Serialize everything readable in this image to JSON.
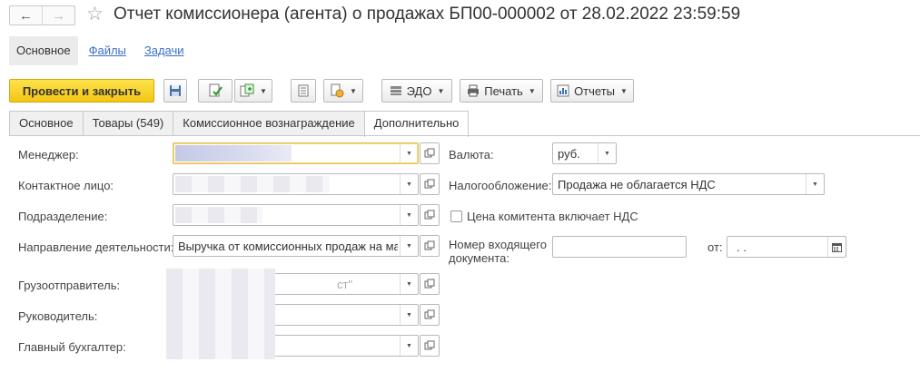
{
  "window": {
    "title": "Отчет комиссионера (агента) о продажах БП00-000002 от 28.02.2022 23:59:59"
  },
  "topnav": [
    {
      "label": "Основное"
    },
    {
      "label": "Файлы"
    },
    {
      "label": "Задачи"
    }
  ],
  "toolbar": {
    "post_close": "Провести и закрыть",
    "edo": "ЭДО",
    "print": "Печать",
    "reports": "Отчеты"
  },
  "tabs": [
    {
      "label": "Основное"
    },
    {
      "label": "Товары (549)"
    },
    {
      "label": "Комиссионное вознаграждение"
    },
    {
      "label": "Дополнительно"
    }
  ],
  "form": {
    "manager_label": "Менеджер:",
    "contact_label": "Контактное лицо:",
    "department_label": "Подразделение:",
    "activity_label": "Направление деятельности:",
    "activity_value": "Выручка от комиссионных продаж на ма",
    "shipper_label": "Грузоотправитель:",
    "shipper_value": "ст\"",
    "director_label": "Руководитель:",
    "accountant_label": "Главный бухгалтер:",
    "currency_label": "Валюта:",
    "currency_value": "руб.",
    "taxation_label": "Налогообложение:",
    "taxation_value": "Продажа не облагается НДС",
    "price_vat_label": "Цена комитента включает НДС",
    "incoming_doc_label_1": "Номер входящего",
    "incoming_doc_label_2": "документа:",
    "from_label": "от:",
    "date_value": " .  ."
  },
  "colors": {
    "primary_button": "#f3c614",
    "link": "#3a6fc4",
    "focus_border": "#e8c14a"
  }
}
